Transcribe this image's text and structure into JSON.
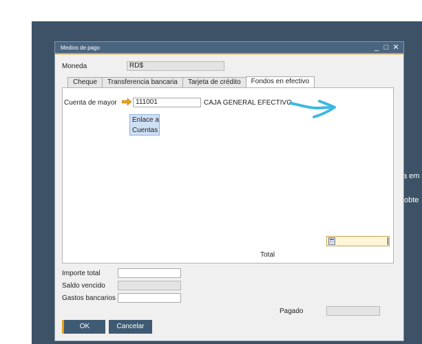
{
  "background": {
    "text_line_1": "a em",
    "text_line_2": "obte"
  },
  "dialog": {
    "title": "Medios de pago",
    "controls": {
      "minimize": "_",
      "maximize": "□",
      "close": "✕"
    },
    "currency": {
      "label": "Moneda",
      "value": "RD$"
    },
    "tabs": [
      {
        "label": "Cheque",
        "active": false
      },
      {
        "label": "Transferencia bancaria",
        "active": false
      },
      {
        "label": "Tarjeta de crédito",
        "active": false
      },
      {
        "label": "Fondos en efectivo",
        "active": true
      }
    ],
    "cash_tab": {
      "account_label": "Cuenta de mayor",
      "account_value": "111001",
      "account_name": "CAJA GENERAL EFECTIVO",
      "link_button_line1": "Enlace a",
      "link_button_line2": "Cuentas",
      "total_label": "Total",
      "total_value": ""
    },
    "summary": {
      "total_amount_label": "Importe total",
      "total_amount_value": "",
      "overdue_label": "Saldo vencido",
      "overdue_value": "",
      "bank_charges_label": "Gastos bancarios",
      "bank_charges_value": "",
      "paid_label": "Pagado",
      "paid_value": ""
    },
    "buttons": {
      "ok": "OK",
      "cancel": "Cancelar"
    }
  },
  "colors": {
    "titlebar": "#4a6580",
    "accent": "#e8a019",
    "annotation": "#3fb8e0"
  },
  "icons": [
    "arrow-right-icon",
    "calculator-icon",
    "annotation-scribble"
  ]
}
